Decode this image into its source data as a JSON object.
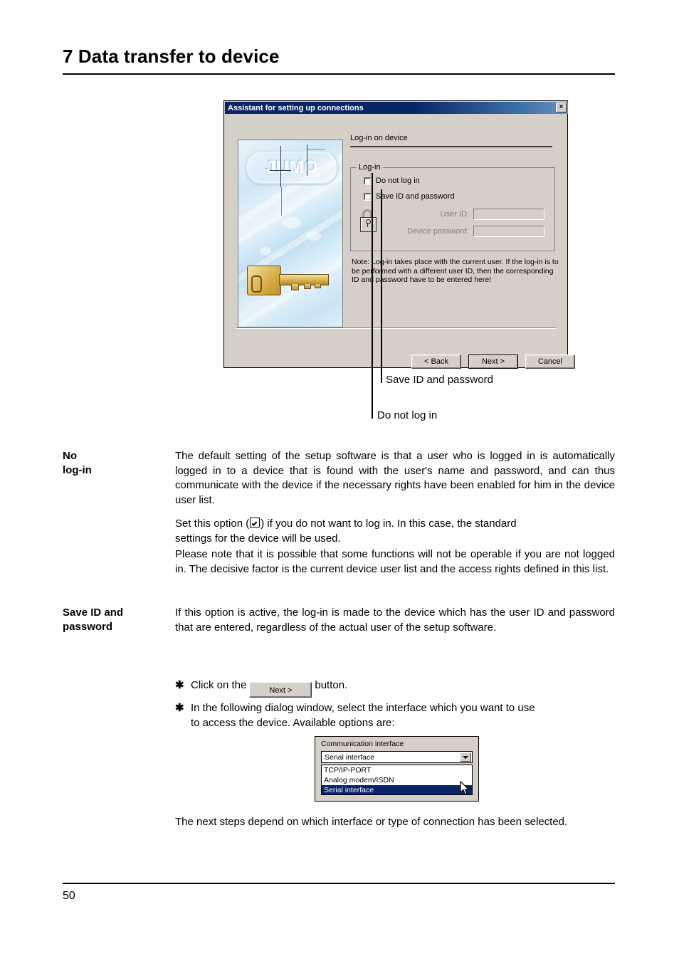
{
  "document": {
    "chapter_title": "7 Data transfer to device",
    "page_number": "50"
  },
  "dialog": {
    "title": "Assistant for setting up connections",
    "close_icon": "×",
    "heading": "Log-in on device",
    "group_label": "Log-in",
    "checkboxes": [
      {
        "label": "Do not log in",
        "checked": false
      },
      {
        "label": "Save ID and password",
        "checked": false
      }
    ],
    "fields": [
      {
        "label": "User ID:",
        "value": "",
        "disabled": true
      },
      {
        "label": "Device password:",
        "value": "",
        "disabled": true
      }
    ],
    "note": "Note: Log-in takes place with the current user. If the log-in is to be performed with a different user ID, then the corresponding ID and password have to be entered here!",
    "buttons": {
      "back": "< Back",
      "next": "Next >",
      "cancel": "Cancel"
    },
    "panel_logo": "JUMO",
    "padlock_icon": "padlock-open-icon",
    "key_icon": "key-icon"
  },
  "callouts": {
    "save_id": "Save ID and password",
    "do_not_log_in": "Do not log in"
  },
  "sections": [
    {
      "label_line1": "No",
      "label_line2": "log-in",
      "paragraphs": [
        "The default setting of the setup software is that a user who is logged in is automatically logged in to a device that is found with the user's name and password, and can thus communicate with the device if the necessary rights have been enabled for him in the device user list.",
        "Set this option (☑) if you do not want to log in. In this case, the standard settings for the device will be used.",
        "Please note that it is possible that some functions will not be operable if you are not logged in. The decisive factor is the current device user list and the access rights defined in this list."
      ]
    },
    {
      "label_line1": "Save ID and",
      "label_line2": "password",
      "paragraphs": [
        "If this option is active, the log-in is made to the device which has the user ID and password that are entered, regardless of the actual user of the setup software."
      ]
    }
  ],
  "paragraph_parts": {
    "set_option_pre": "Set this option (",
    "set_option_post": ") if you do not want to log in. In this case, the standard",
    "set_option_line2": "settings for the device will be used."
  },
  "bullets": [
    {
      "marker": "✱",
      "text_before": "Click on the",
      "button_label": "Next >",
      "text_after": "button."
    },
    {
      "marker": "✱",
      "text_line1": "In the following dialog window, select the interface which you want to use",
      "text_line2": "to access the device. Available options are:"
    }
  ],
  "combo": {
    "label": "Communication interface",
    "selected_value": "Serial interface",
    "arrow_icon": "chevron-down-icon",
    "options": [
      {
        "label": "TCP/IP-PORT",
        "selected": false
      },
      {
        "label": "Analog modem/ISDN",
        "selected": false
      },
      {
        "label": "Serial interface",
        "selected": true
      }
    ]
  },
  "closing_paragraph": "The next steps depend on which interface or type of connection has been selected.",
  "colors": {
    "titlebar_start": "#0a246a",
    "dialog_face": "#d4d0c8",
    "selection_blue": "#0a246a",
    "key_gold": "#d6ad44"
  }
}
